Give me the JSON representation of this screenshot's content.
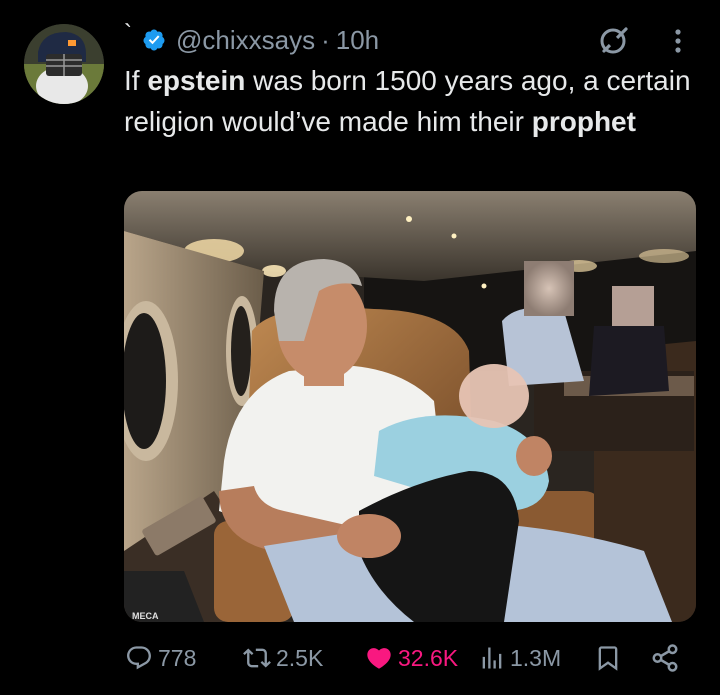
{
  "tweet": {
    "name_glyph": "`",
    "handle": "@chixxsays",
    "separator": "·",
    "time": "10h",
    "text_parts": [
      "If ",
      "epstein",
      " was born 1500 years ago, a certain religion would’ve made him their ",
      "prophet"
    ],
    "image_text": "MECA"
  },
  "actions": {
    "replies": "778",
    "reposts": "2.5K",
    "likes": "32.6K",
    "views": "1.3M"
  },
  "colors": {
    "background": "#000000",
    "text": "#e7e9ea",
    "secondary": "#8b98a5",
    "verified": "#1d9bf0",
    "like": "#f91880"
  },
  "icons": {
    "verified": "verified-badge-icon",
    "grok": "grok-icon",
    "more": "more-icon",
    "reply": "reply-icon",
    "repost": "repost-icon",
    "like": "heart-icon",
    "views": "views-icon",
    "bookmark": "bookmark-icon",
    "share": "share-icon"
  }
}
